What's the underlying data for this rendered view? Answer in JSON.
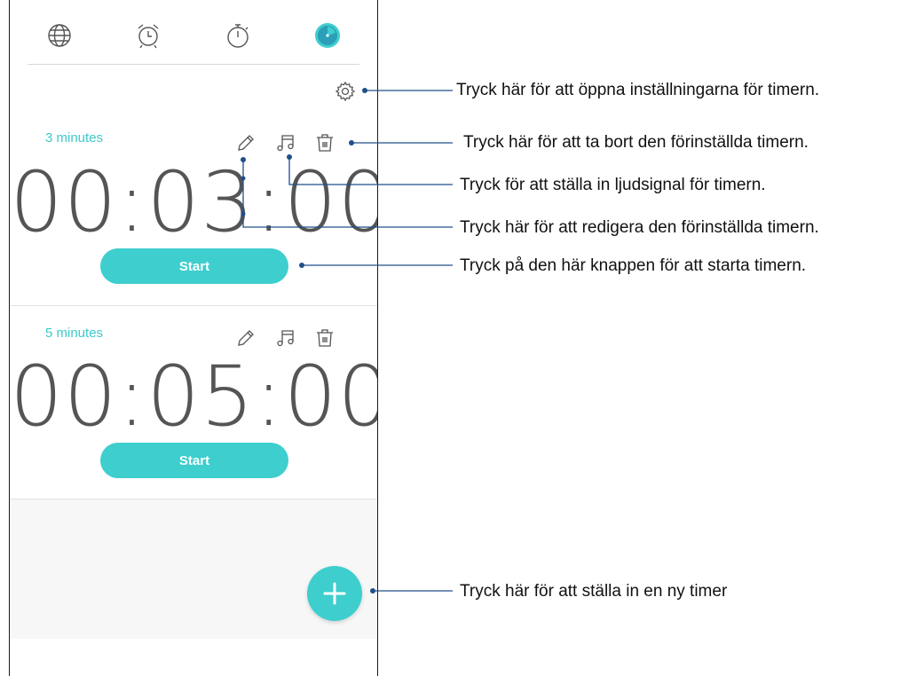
{
  "tabs": [
    {
      "name": "world-clock",
      "icon": "globe-icon"
    },
    {
      "name": "alarm",
      "icon": "alarm-clock-icon"
    },
    {
      "name": "stopwatch",
      "icon": "stopwatch-icon"
    },
    {
      "name": "timer",
      "icon": "timer-icon",
      "active": true
    }
  ],
  "timers": [
    {
      "name": "3 minutes",
      "time": "00:03:00",
      "start_label": "Start"
    },
    {
      "name": "5 minutes",
      "time": "00:05:00",
      "start_label": "Start"
    }
  ],
  "callouts": {
    "settings": "Tryck här för att öppna inställningarna för timern.",
    "delete": "Tryck här för att ta bort den förinställda timern.",
    "sound": "Tryck för att ställa in ljudsignal för timern.",
    "edit": "Tryck här för att redigera den förinställda timern.",
    "start": "Tryck på den här knappen för att starta timern.",
    "add": "Tryck här för att ställa in en ny timer"
  },
  "colors": {
    "accent": "#3ecece",
    "label": "#3ec9c9",
    "callout_line": "#1f4f8a"
  }
}
